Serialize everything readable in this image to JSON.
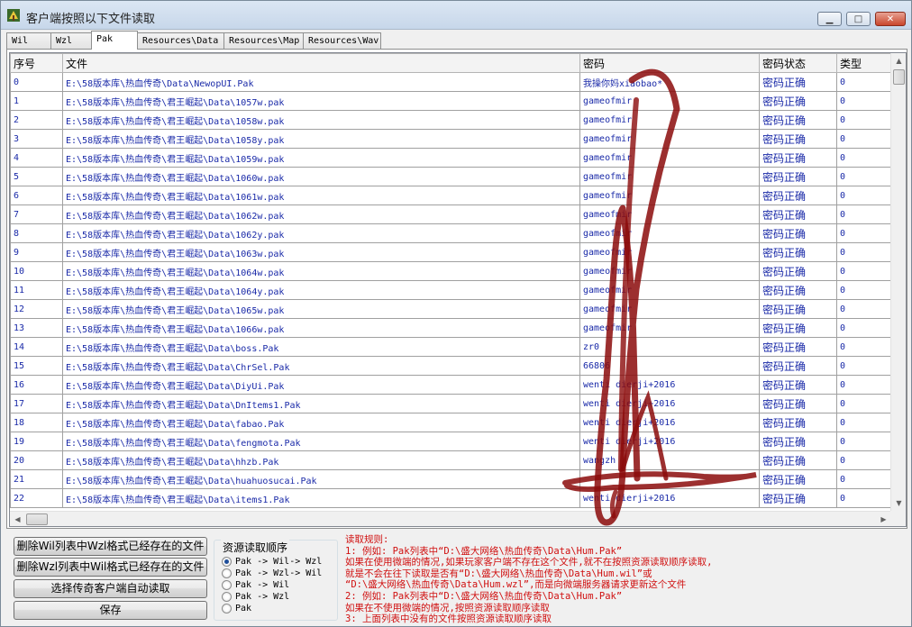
{
  "window": {
    "title": "客户端按照以下文件读取"
  },
  "tabs": [
    {
      "label": "Wil",
      "active": false
    },
    {
      "label": "Wzl",
      "active": false
    },
    {
      "label": "Pak",
      "active": true
    },
    {
      "label": "Resources\\Data",
      "active": false
    },
    {
      "label": "Resources\\Map",
      "active": false
    },
    {
      "label": "Resources\\Wav",
      "active": false
    }
  ],
  "table": {
    "headers": {
      "index": "序号",
      "file": "文件",
      "password": "密码",
      "status": "密码状态",
      "type": "类型"
    },
    "rows": [
      {
        "index": "0",
        "file": "E:\\58版本库\\热血传奇\\Data\\NewopUI.Pak",
        "password": "我操你妈xiaobao*",
        "status": "密码正确",
        "type": "0"
      },
      {
        "index": "1",
        "file": "E:\\58版本库\\热血传奇\\君王崛起\\Data\\1057w.pak",
        "password": "gameofmir",
        "status": "密码正确",
        "type": "0"
      },
      {
        "index": "2",
        "file": "E:\\58版本库\\热血传奇\\君王崛起\\Data\\1058w.pak",
        "password": "gameofmir",
        "status": "密码正确",
        "type": "0"
      },
      {
        "index": "3",
        "file": "E:\\58版本库\\热血传奇\\君王崛起\\Data\\1058y.pak",
        "password": "gameofmir",
        "status": "密码正确",
        "type": "0"
      },
      {
        "index": "4",
        "file": "E:\\58版本库\\热血传奇\\君王崛起\\Data\\1059w.pak",
        "password": "gameofmir",
        "status": "密码正确",
        "type": "0"
      },
      {
        "index": "5",
        "file": "E:\\58版本库\\热血传奇\\君王崛起\\Data\\1060w.pak",
        "password": "gameofmir",
        "status": "密码正确",
        "type": "0"
      },
      {
        "index": "6",
        "file": "E:\\58版本库\\热血传奇\\君王崛起\\Data\\1061w.pak",
        "password": "gameofmir",
        "status": "密码正确",
        "type": "0"
      },
      {
        "index": "7",
        "file": "E:\\58版本库\\热血传奇\\君王崛起\\Data\\1062w.pak",
        "password": "gameofmir",
        "status": "密码正确",
        "type": "0"
      },
      {
        "index": "8",
        "file": "E:\\58版本库\\热血传奇\\君王崛起\\Data\\1062y.pak",
        "password": "gameofmir",
        "status": "密码正确",
        "type": "0"
      },
      {
        "index": "9",
        "file": "E:\\58版本库\\热血传奇\\君王崛起\\Data\\1063w.pak",
        "password": "gameofmir",
        "status": "密码正确",
        "type": "0"
      },
      {
        "index": "10",
        "file": "E:\\58版本库\\热血传奇\\君王崛起\\Data\\1064w.pak",
        "password": "gameofmir",
        "status": "密码正确",
        "type": "0"
      },
      {
        "index": "11",
        "file": "E:\\58版本库\\热血传奇\\君王崛起\\Data\\1064y.pak",
        "password": "gameofmir",
        "status": "密码正确",
        "type": "0"
      },
      {
        "index": "12",
        "file": "E:\\58版本库\\热血传奇\\君王崛起\\Data\\1065w.pak",
        "password": "gameofmir",
        "status": "密码正确",
        "type": "0"
      },
      {
        "index": "13",
        "file": "E:\\58版本库\\热血传奇\\君王崛起\\Data\\1066w.pak",
        "password": "gameofmir",
        "status": "密码正确",
        "type": "0"
      },
      {
        "index": "14",
        "file": "E:\\58版本库\\热血传奇\\君王崛起\\Data\\boss.Pak",
        "password": "zr0",
        "status": "密码正确",
        "type": "0"
      },
      {
        "index": "15",
        "file": "E:\\58版本库\\热血传奇\\君王崛起\\Data\\ChrSel.Pak",
        "password": "66806",
        "status": "密码正确",
        "type": "0"
      },
      {
        "index": "16",
        "file": "E:\\58版本库\\热血传奇\\君王崛起\\Data\\DiyUi.Pak",
        "password": "wenti dierji+2016",
        "status": "密码正确",
        "type": "0"
      },
      {
        "index": "17",
        "file": "E:\\58版本库\\热血传奇\\君王崛起\\Data\\DnItems1.Pak",
        "password": "wenti dierji+2016",
        "status": "密码正确",
        "type": "0"
      },
      {
        "index": "18",
        "file": "E:\\58版本库\\热血传奇\\君王崛起\\Data\\fabao.Pak",
        "password": "wenti dierji+2016",
        "status": "密码正确",
        "type": "0"
      },
      {
        "index": "19",
        "file": "E:\\58版本库\\热血传奇\\君王崛起\\Data\\fengmota.Pak",
        "password": "wenti dierji+2016",
        "status": "密码正确",
        "type": "0"
      },
      {
        "index": "20",
        "file": "E:\\58版本库\\热血传奇\\君王崛起\\Data\\hhzb.Pak",
        "password": "wangzh",
        "status": "密码正确",
        "type": "0"
      },
      {
        "index": "21",
        "file": "E:\\58版本库\\热血传奇\\君王崛起\\Data\\huahuosucai.Pak",
        "password": "",
        "status": "密码正确",
        "type": "0"
      },
      {
        "index": "22",
        "file": "E:\\58版本库\\热血传奇\\君王崛起\\Data\\items1.Pak",
        "password": "wenti dierji+2016",
        "status": "密码正确",
        "type": "0"
      }
    ]
  },
  "buttons": {
    "delete_wil": "删除Wil列表中Wzl格式已经存在的文件",
    "delete_wzl": "删除Wzl列表中Wil格式已经存在的文件",
    "auto_read": "选择传奇客户端自动读取",
    "save": "保存"
  },
  "resource_order": {
    "title": "资源读取顺序",
    "options": [
      {
        "label": "Pak -> Wil-> Wzl",
        "checked": true
      },
      {
        "label": "Pak -> Wzl-> Wil",
        "checked": false
      },
      {
        "label": "Pak -> Wil",
        "checked": false
      },
      {
        "label": "Pak -> Wzl",
        "checked": false
      },
      {
        "label": "Pak",
        "checked": false
      }
    ]
  },
  "rules": {
    "lines": [
      "读取规则:",
      "1: 例如: Pak列表中“D:\\盛大网络\\热血传奇\\Data\\Hum.Pak”",
      "   如果在使用微端的情况,如果玩家客户端不存在这个文件,就不在按照资源读取顺序读取,",
      "   就是不会在往下读取是否有“D:\\盛大网络\\热血传奇\\Data\\Hum.wil”或",
      "   “D:\\盛大网络\\热血传奇\\Data\\Hum.wzl”,而是向微端服务器请求更新这个文件",
      "2: 例如: Pak列表中“D:\\盛大网络\\热血传奇\\Data\\Hum.Pak”",
      "   如果在不使用微端的情况,按照资源读取顺序读取",
      "3: 上面列表中没有的文件按照资源读取顺序读取"
    ]
  },
  "colors": {
    "cell_text": "#1a2aa8",
    "rules_text": "#d01010",
    "scribble": "#8b0a0a"
  }
}
